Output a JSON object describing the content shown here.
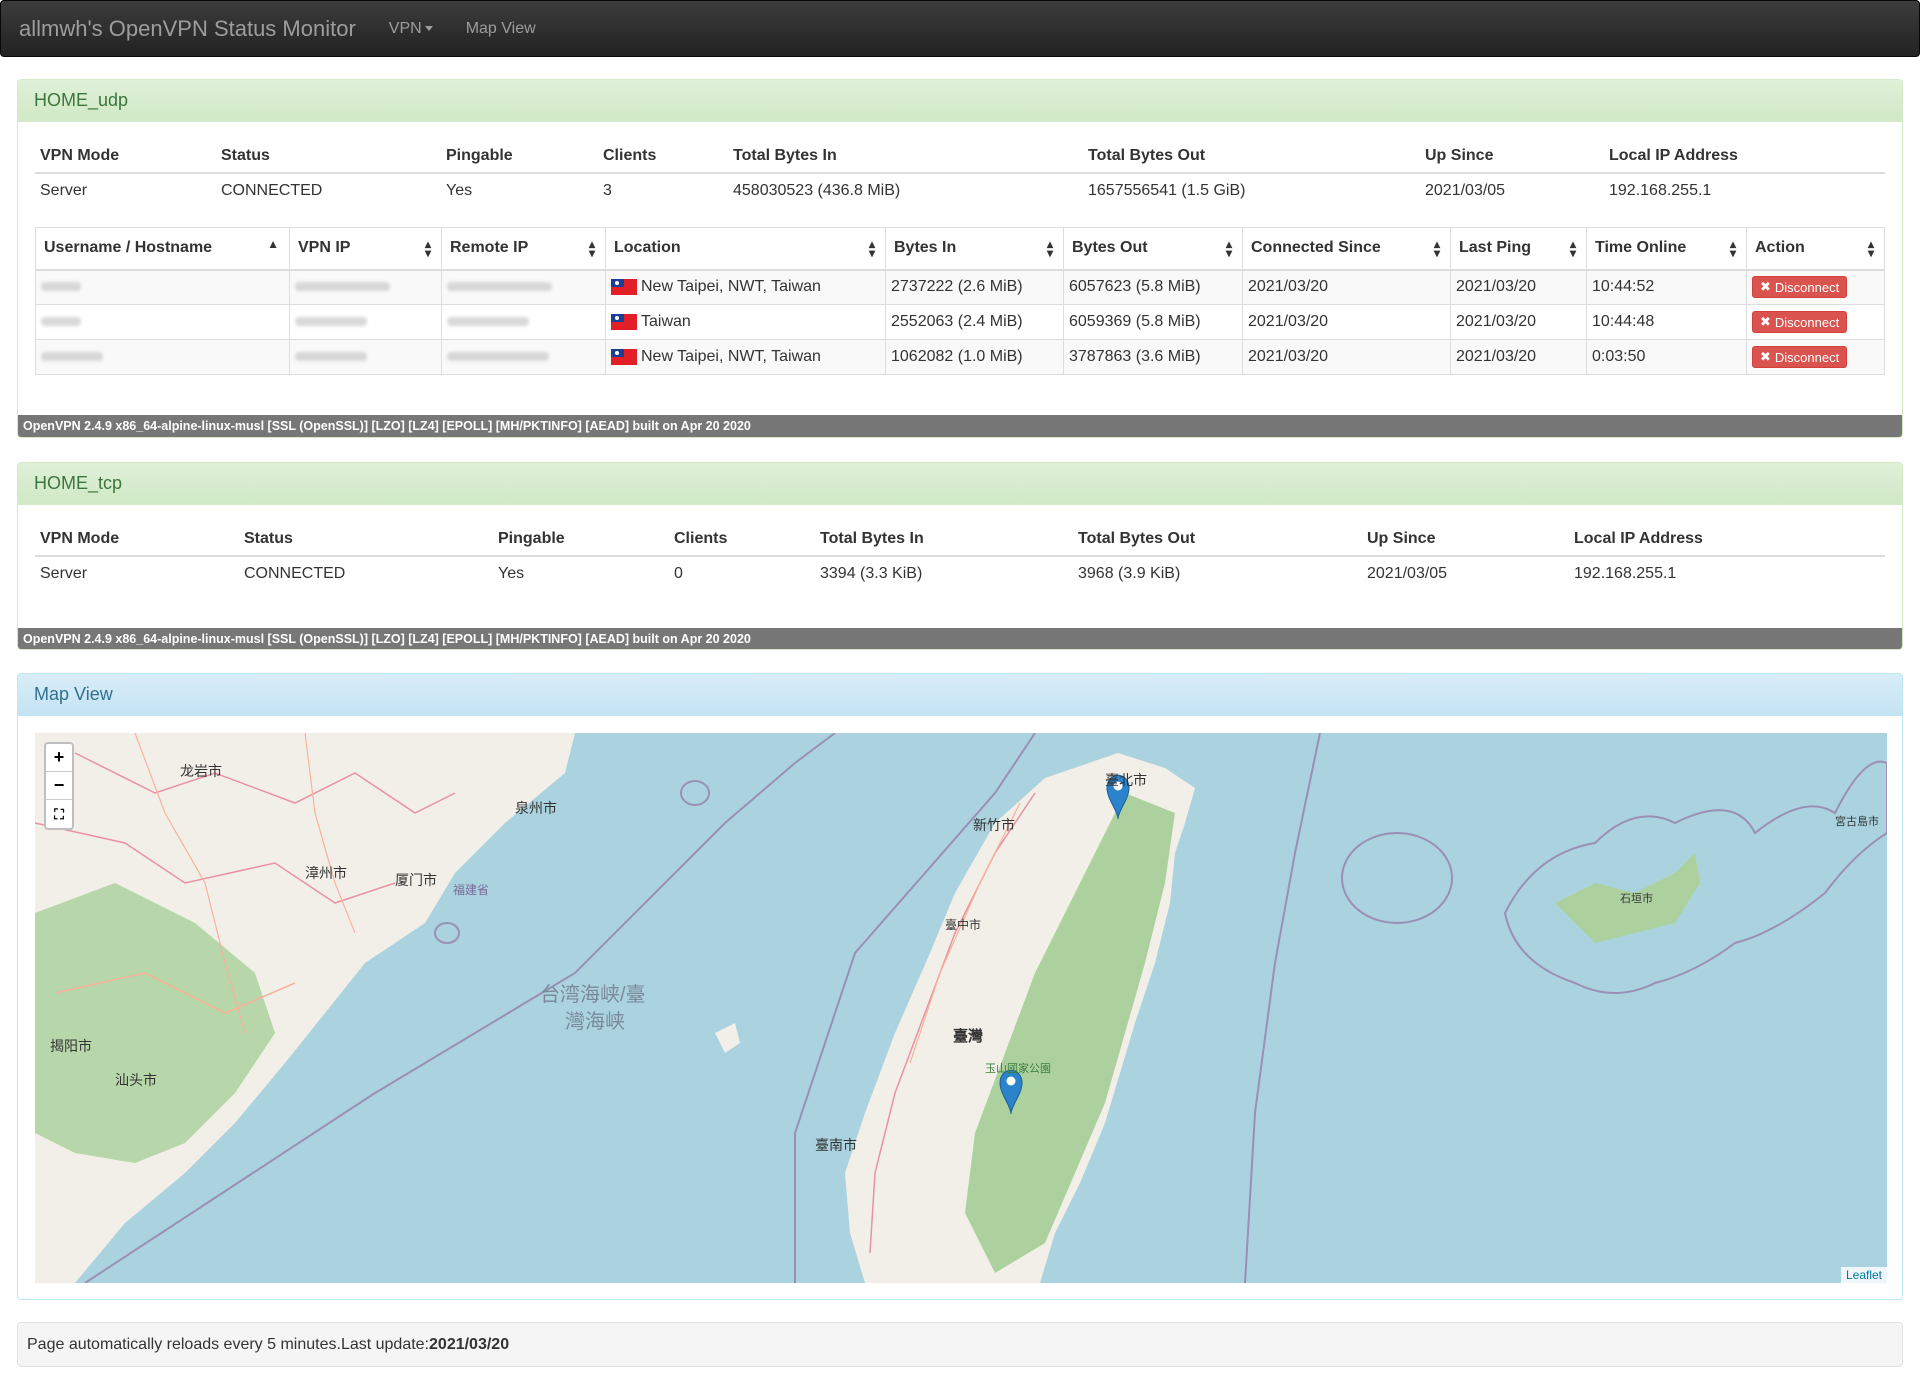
{
  "navbar": {
    "brand": "allmwh's OpenVPN Status Monitor",
    "vpn_menu": "VPN",
    "map_view": "Map View"
  },
  "summary_headers": [
    "VPN Mode",
    "Status",
    "Pingable",
    "Clients",
    "Total Bytes In",
    "Total Bytes Out",
    "Up Since",
    "Local IP Address"
  ],
  "udp": {
    "title": "HOME_udp",
    "summary": {
      "mode": "Server",
      "status": "CONNECTED",
      "pingable": "Yes",
      "clients": "3",
      "bytes_in": "458030523 (436.8 MiB)",
      "bytes_out": "1657556541 (1.5 GiB)",
      "up_since": "2021/03/05",
      "local_ip": "192.168.255.1"
    },
    "client_headers": [
      "Username / Hostname",
      "VPN IP",
      "Remote IP",
      "Location",
      "Bytes In",
      "Bytes Out",
      "Connected Since",
      "Last Ping",
      "Time Online",
      "Action"
    ],
    "clients": [
      {
        "location": "New Taipei, NWT, Taiwan",
        "bytes_in": "2737222 (2.6 MiB)",
        "bytes_out": "6057623 (5.8 MiB)",
        "connected_since": "2021/03/20",
        "last_ping": "2021/03/20",
        "time_online": "10:44:52",
        "action": "Disconnect"
      },
      {
        "location": "Taiwan",
        "bytes_in": "2552063 (2.4 MiB)",
        "bytes_out": "6059369 (5.8 MiB)",
        "connected_since": "2021/03/20",
        "last_ping": "2021/03/20",
        "time_online": "10:44:48",
        "action": "Disconnect"
      },
      {
        "location": "New Taipei, NWT, Taiwan",
        "bytes_in": "1062082 (1.0 MiB)",
        "bytes_out": "3787863 (3.6 MiB)",
        "connected_since": "2021/03/20",
        "last_ping": "2021/03/20",
        "time_online": "0:03:50",
        "action": "Disconnect"
      }
    ],
    "build": "OpenVPN 2.4.9 x86_64-alpine-linux-musl [SSL (OpenSSL)] [LZO] [LZ4] [EPOLL] [MH/PKTINFO] [AEAD] built on Apr 20 2020"
  },
  "tcp": {
    "title": "HOME_tcp",
    "summary": {
      "mode": "Server",
      "status": "CONNECTED",
      "pingable": "Yes",
      "clients": "0",
      "bytes_in": "3394 (3.3 KiB)",
      "bytes_out": "3968 (3.9 KiB)",
      "up_since": "2021/03/05",
      "local_ip": "192.168.255.1"
    },
    "build": "OpenVPN 2.4.9 x86_64-alpine-linux-musl [SSL (OpenSSL)] [LZO] [LZ4] [EPOLL] [MH/PKTINFO] [AEAD] built on Apr 20 2020"
  },
  "map": {
    "title": "Map View",
    "zoom_in": "+",
    "zoom_out": "−",
    "attribution": "Leaflet",
    "labels": {
      "strait": "台湾海峡/臺",
      "strait2": "灣海峡",
      "taipei": "臺北市",
      "hsinchu": "新竹市",
      "taichung": "臺中市",
      "taiwan": "臺灣",
      "tainan": "臺南市",
      "xiamen": "厦门市",
      "quanzhou": "泉州市",
      "zhangzhou": "漳州市",
      "longyan": "龙岩市",
      "shantou": "汕头市",
      "jieyang": "揭阳市",
      "fujian": "福建省",
      "shigaki": "石垣市",
      "miyako": "宮古島市",
      "yushan": "玉山國家公園"
    },
    "colors": {
      "sea": "#aad3df",
      "land": "#f2efe9",
      "forest": "#add19e",
      "marker": "#2b83cb"
    }
  },
  "footer": {
    "text": "Page automatically reloads every 5 minutes.Last update: ",
    "last_update": "2021/03/20"
  }
}
